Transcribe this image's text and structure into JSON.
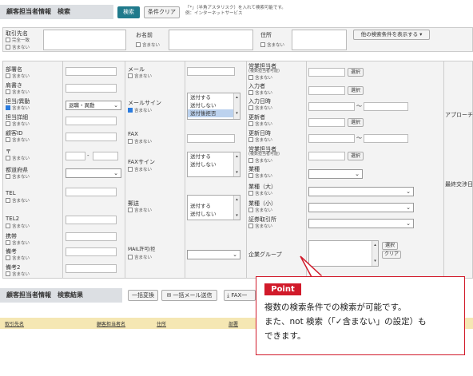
{
  "search_header": {
    "title": "顧客担当者情報　検索",
    "search_button": "検索",
    "clear_button": "条件クリア",
    "note_line1": "「*」（半角アスタリスク）を入れて検索可能です。",
    "note_line2": "例：インターネットサービス"
  },
  "top_row": {
    "company": {
      "label": "取引先名",
      "opt1": "完全一致",
      "opt2": "含まない"
    },
    "name": {
      "label": "お名前",
      "opt": "含まない"
    },
    "address": {
      "label": "住所",
      "opt": "含まない"
    },
    "more_button": "他の検索条件を表示する ▾"
  },
  "exclude": "含まない",
  "fields_col1": [
    {
      "label": "部署名"
    },
    {
      "label": "肩書き"
    },
    {
      "label": "担当/異動",
      "checked": true,
      "select": "退職・異動"
    },
    {
      "label": "担当詳細"
    },
    {
      "label": "顧客ID"
    },
    {
      "label": "〒"
    },
    {
      "label": "都道府県"
    },
    {
      "label": "TEL"
    },
    {
      "label": "TEL2"
    },
    {
      "label": "携帯"
    },
    {
      "label": "備考"
    },
    {
      "label": "備考2"
    }
  ],
  "fields_col2": {
    "mail": "メール",
    "mail_sign": "メールサイン",
    "fax": "FAX",
    "fax_sign": "FAXサイン",
    "mailing": "郵送",
    "mail_allow": "MAIL許可/拒"
  },
  "send_options": [
    "送付する",
    "送付しない",
    "送付後拒否"
  ],
  "fields_col3": {
    "sales_rep": "営業担当者",
    "sales_rep_note": "(複数担当者可能)",
    "entry_date": "入力者",
    "entry_datetime": "入力日時",
    "updater": "更新者",
    "update_datetime": "更新日時",
    "sales_rep2": "営業担当者",
    "sales_rep2_note": "(複数担当者可能)",
    "industry": "業種",
    "industry_large": "業種（大）",
    "industry_small": "業種（小）",
    "stock": "証券取引所",
    "group": "企業グループ",
    "select_btn": "選択",
    "clear_btn": "クリア",
    "tilde": "〜"
  },
  "right_edge": {
    "approach": "アプローチ",
    "last_contact": "最終交渉日"
  },
  "results": {
    "title": "顧客担当者情報　検索結果",
    "bulk_convert": "一括変換",
    "bulk_mail": "一括メール送信",
    "fax": "FAX一",
    "columns": [
      "取引先名",
      "顧客担当者名",
      "住所",
      "部署"
    ]
  },
  "callout": {
    "badge": "Point",
    "line1": "複数の検索条件での検索が可能です。",
    "line2": "また、not 検索（「✓含まない」の設定）も",
    "line3": "できます。"
  },
  "colors": {
    "accent": "#1f7a8c",
    "callout_red": "#d11a2a",
    "result_header": "#f5e7b3",
    "checked_blue": "#2a7bde"
  }
}
